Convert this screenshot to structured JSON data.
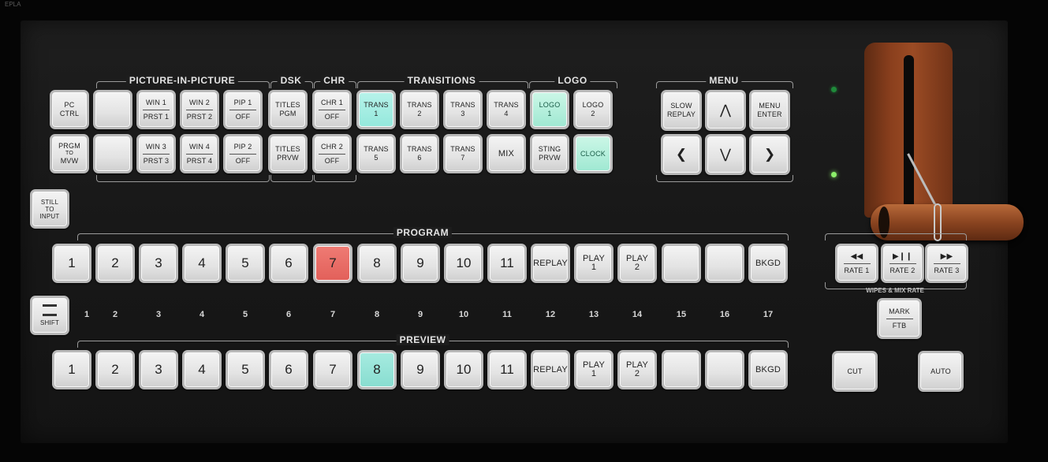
{
  "corner_text": "EPLA",
  "groups": {
    "pip": "PICTURE-IN-PICTURE",
    "dsk": "DSK",
    "chr": "CHR",
    "transitions": "TRANSITIONS",
    "logo": "LOGO",
    "menu": "MENU",
    "program": "PROGRAM",
    "preview": "PREVIEW",
    "wipes": "WIPES & MIX RATE"
  },
  "top_row1": {
    "pc": [
      "PC",
      "CTRL"
    ],
    "blank": "",
    "win1": [
      "WIN 1",
      "PRST 1"
    ],
    "win2": [
      "WIN 2",
      "PRST 2"
    ],
    "pip1": [
      "PIP 1",
      "OFF"
    ],
    "titles_pgm": [
      "TITLES",
      "PGM"
    ],
    "chr1": [
      "CHR 1",
      "OFF"
    ],
    "trans1": [
      "TRANS",
      "1"
    ],
    "trans2": [
      "TRANS",
      "2"
    ],
    "trans3": [
      "TRANS",
      "3"
    ],
    "trans4": [
      "TRANS",
      "4"
    ],
    "logo1": [
      "LOGO",
      "1"
    ],
    "logo2": [
      "LOGO",
      "2"
    ]
  },
  "top_row2": {
    "prgm": [
      "PRGM",
      "TO",
      "MVW"
    ],
    "blank": "",
    "win3": [
      "WIN 3",
      "PRST 3"
    ],
    "win4": [
      "WIN 4",
      "PRST 4"
    ],
    "pip2": [
      "PIP 2",
      "OFF"
    ],
    "titles_prvw": [
      "TITLES",
      "PRVW"
    ],
    "chr2": [
      "CHR 2",
      "OFF"
    ],
    "trans5": [
      "TRANS",
      "5"
    ],
    "trans6": [
      "TRANS",
      "6"
    ],
    "trans7": [
      "TRANS",
      "7"
    ],
    "mix": "MIX",
    "sting": [
      "STING",
      "PRVW"
    ],
    "clock": "CLOCK"
  },
  "menu": {
    "slow_replay": [
      "SLOW",
      "REPLAY"
    ],
    "up": "⋀",
    "menu_enter": [
      "MENU",
      "ENTER"
    ],
    "left": "❮",
    "down": "⋁",
    "right": "❯"
  },
  "still": [
    "STILL",
    "TO",
    "INPUT"
  ],
  "shift": "SHIFT",
  "program_buttons": [
    "1",
    "2",
    "3",
    "4",
    "5",
    "6",
    "7",
    "8",
    "9",
    "10",
    "11",
    "REPLAY",
    [
      "PLAY",
      "1"
    ],
    [
      "PLAY",
      "2"
    ],
    "",
    "",
    "BKGD"
  ],
  "numbers": [
    "1",
    "2",
    "3",
    "4",
    "5",
    "6",
    "7",
    "8",
    "9",
    "10",
    "11",
    "12",
    "13",
    "14",
    "15",
    "16",
    "17"
  ],
  "preview_buttons": [
    "1",
    "2",
    "3",
    "4",
    "5",
    "6",
    "7",
    "8",
    "9",
    "10",
    "11",
    "REPLAY",
    [
      "PLAY",
      "1"
    ],
    [
      "PLAY",
      "2"
    ],
    "",
    "",
    "BKGD"
  ],
  "rate_buttons": [
    {
      "icon": "◀◀",
      "label": "RATE 1"
    },
    {
      "icon": "▶❙❙",
      "label": "RATE 2"
    },
    {
      "icon": "▶▶",
      "label": "RATE 3"
    }
  ],
  "mark": [
    "MARK",
    "FTB"
  ],
  "cut": "CUT",
  "auto": "AUTO",
  "colors": {
    "program_active": "#e2605a",
    "preview_active": "#88ddd0",
    "lit_trans": "#a6ebe0",
    "led_green": "#3de86a"
  },
  "state": {
    "program_selected": "7",
    "preview_selected": "8",
    "lit_buttons": [
      "TRANS 1",
      "LOGO 1",
      "CLOCK"
    ]
  }
}
